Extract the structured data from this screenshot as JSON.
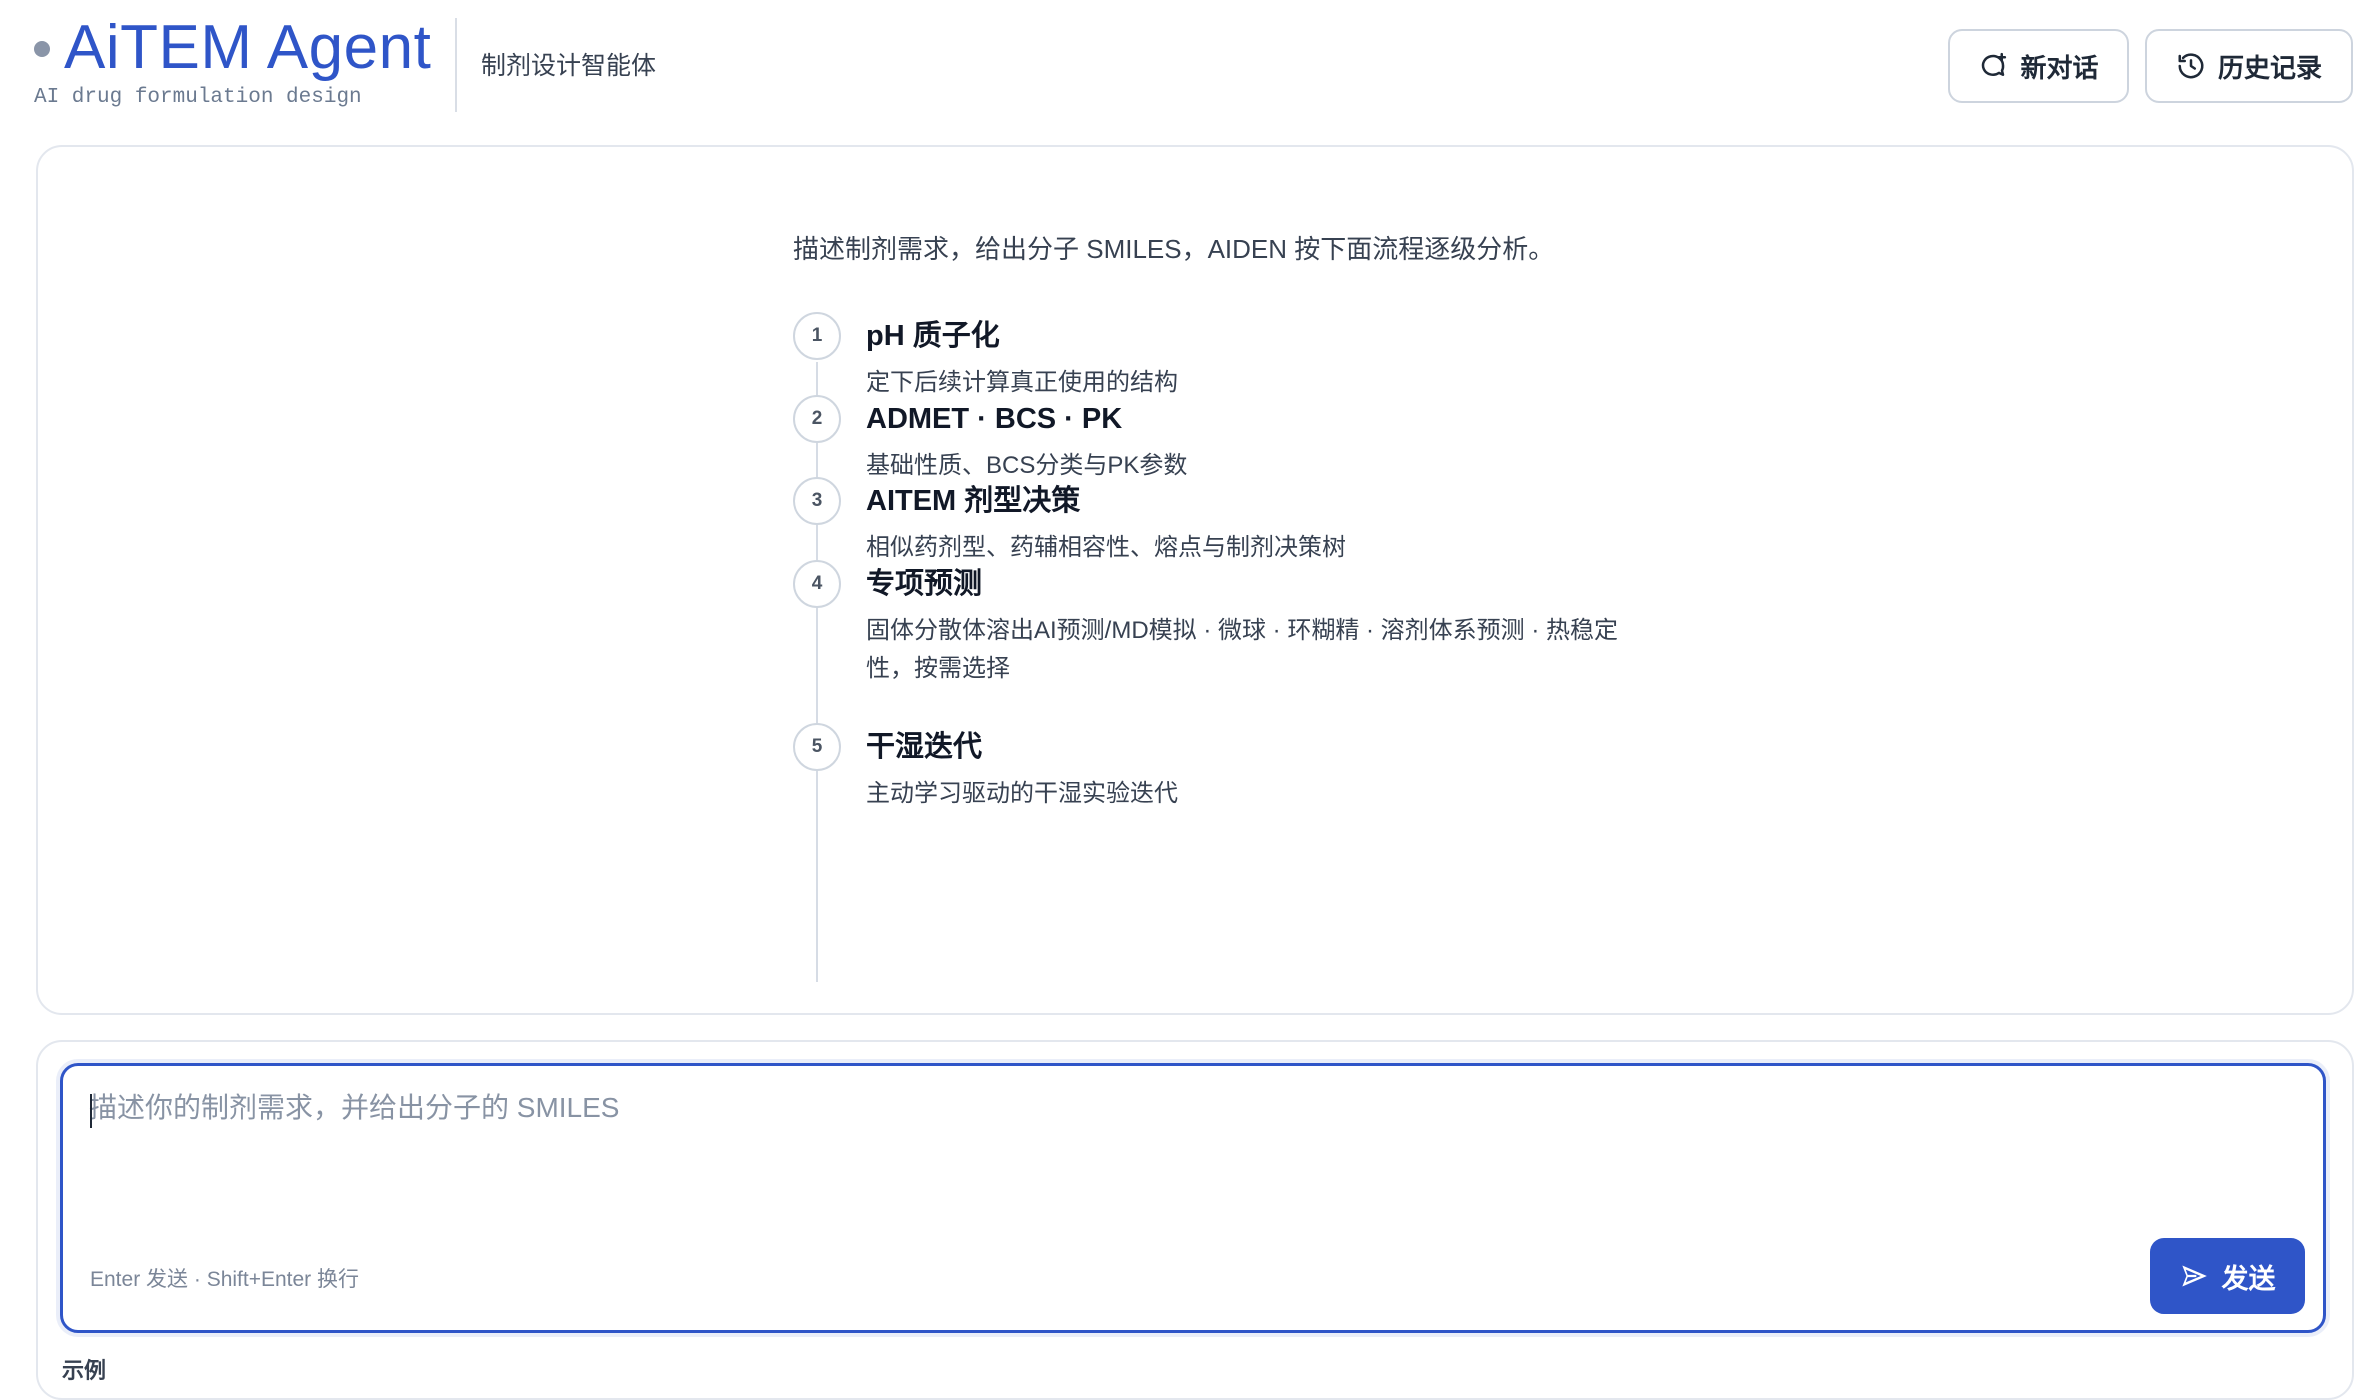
{
  "header": {
    "brand_title": "AiTEM Agent",
    "brand_subtitle": "AI drug formulation design",
    "tagline": "制剂设计智能体",
    "new_chat_label": "新对话",
    "new_chat_icon": "chat-plus-icon",
    "history_label": "历史记录",
    "history_icon": "history-clock-icon"
  },
  "intro": {
    "text": "描述制剂需求，给出分子 SMILES，AIDEN 按下面流程逐级分析。",
    "steps": [
      {
        "num": "1",
        "title": "pH 质子化",
        "desc": "定下后续计算真正使用的结构"
      },
      {
        "num": "2",
        "title": "ADMET · BCS · PK",
        "desc": "基础性质、BCS分类与PK参数"
      },
      {
        "num": "3",
        "title": "AITEM 剂型决策",
        "desc": "相似药剂型、药辅相容性、熔点与制剂决策树"
      },
      {
        "num": "4",
        "title": "专项预测",
        "desc": "固体分散体溶出AI预测/MD模拟 · 微球 · 环糊精 · 溶剂体系预测 · 热稳定性，按需选择"
      },
      {
        "num": "5",
        "title": "干湿迭代",
        "desc": "主动学习驱动的干湿实验迭代"
      }
    ]
  },
  "composer": {
    "placeholder": "描述你的制剂需求，并给出分子的 SMILES",
    "value": "",
    "hint": "Enter 发送 · Shift+Enter 换行",
    "send_label": "发送",
    "send_icon": "send-arrow-icon"
  },
  "examples": {
    "label": "示例"
  },
  "colors": {
    "accent": "#2f55c8",
    "border": "#e3e7ee",
    "muted_text": "#7b8698"
  }
}
